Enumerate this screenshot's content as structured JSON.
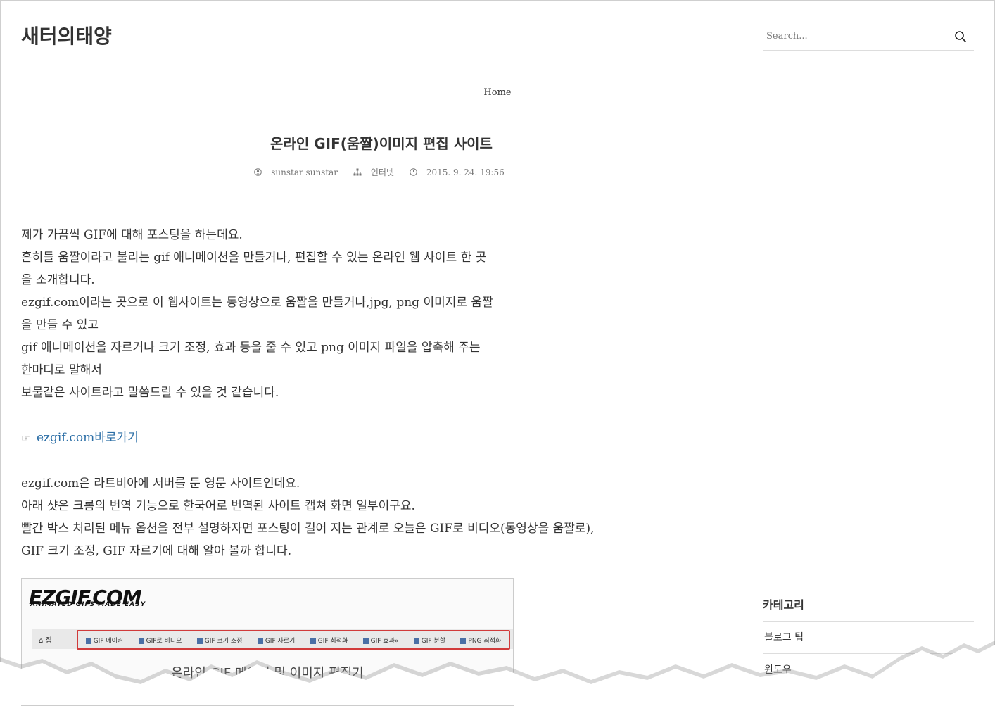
{
  "header": {
    "site_title": "새터의태양",
    "search_placeholder": "Search..."
  },
  "nav": {
    "home_label": "Home"
  },
  "post": {
    "title": "온라인 GIF(움짤)이미지 편집 사이트",
    "author": "sunstar sunstar",
    "category": "인터넷",
    "date": "2015. 9. 24. 19:56",
    "paragraph1": [
      "제가 가끔씩 GIF에 대해 포스팅을 하는데요.",
      "흔히들 움짤이라고 불리는 gif 애니메이션을 만들거나, 편집할 수 있는 온라인 웹 사이트 한 곳",
      "을 소개합니다.",
      "ezgif.com이라는 곳으로 이 웹사이트는 동영상으로 움짤을 만들거나,jpg, png 이미지로 움짤",
      "을 만들 수 있고",
      "gif 애니메이션을 자르거나 크기 조정, 효과 등을 줄 수 있고 png 이미지 파일을 압축해 주는",
      "한마디로 말해서",
      "보물같은 사이트라고 말씀드릴 수 있을 것 같습니다."
    ],
    "link_hand": "☞",
    "link_text": "ezgif.com바로가기",
    "paragraph2": [
      "ezgif.com은 라트비아에 서버를 둔 영문 사이트인데요.",
      "아래 샷은 크롬의 번역 기능으로 한국어로 번역된 사이트 캡쳐 화면 일부이구요.",
      "빨간 박스 처리된 메뉴 옵션을 전부 설명하자면 포스팅이 길어 지는 관계로 오늘은 GIF로 비디오(동영상을 움짤로),",
      "GIF 크기 조정, GIF 자르기에 대해 알아 볼까 합니다."
    ]
  },
  "screenshot": {
    "logo": "EZGIF.COM",
    "tagline": "ANIMATED GIFS MADE EASY",
    "home": "집",
    "menu": [
      "GIF 메이커",
      "GIF로 비디오",
      "GIF 크기 조정",
      "GIF 자르기",
      "GIF 최적화",
      "GIF 효과»",
      "GIF 분할",
      "PNG 최적화"
    ],
    "page_title": "온라인 GIF 메이커 및 이미지 편집기"
  },
  "sidebar": {
    "heading": "카테고리",
    "items": [
      "블로그 팁",
      "윈도우"
    ]
  },
  "colors": {
    "link": "#2b6ea6",
    "highlight_box": "#d13b3b"
  }
}
